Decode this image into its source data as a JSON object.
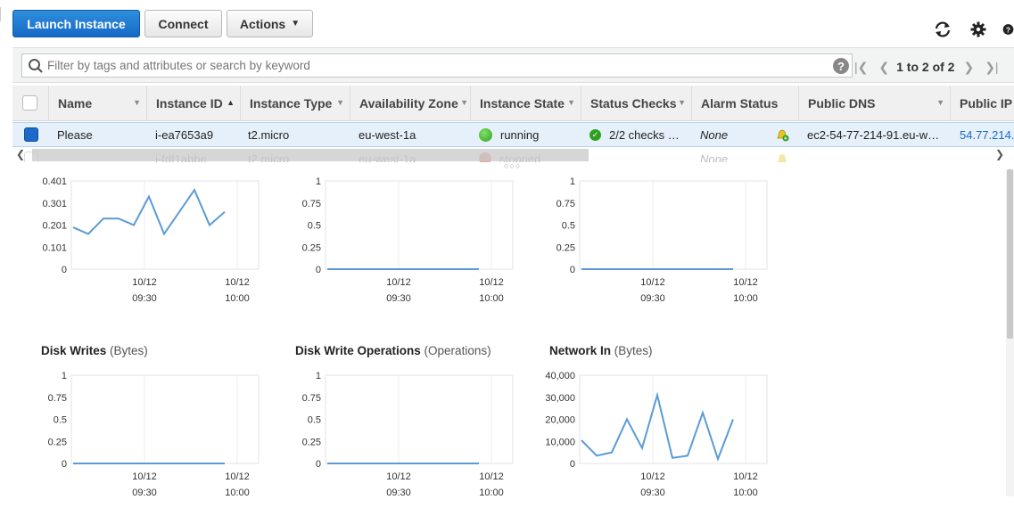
{
  "toolbar": {
    "launch_label": "Launch Instance",
    "connect_label": "Connect",
    "actions_label": "Actions"
  },
  "search": {
    "placeholder": "Filter by tags and attributes or search by keyword",
    "pager_text": "1 to 2 of 2"
  },
  "table": {
    "columns": [
      "Name",
      "Instance ID",
      "Instance Type",
      "Availability Zone",
      "Instance State",
      "Status Checks",
      "Alarm Status",
      "Public DNS",
      "Public IP"
    ],
    "rows": [
      {
        "name": "Please",
        "instance_id": "i-ea7653a9",
        "instance_type": "t2.micro",
        "zone": "eu-west-1a",
        "state": "running",
        "status_checks": "2/2 checks …",
        "alarm": "None",
        "public_dns": "ec2-54-77-214-91.eu-w…",
        "public_ip": "54.77.214."
      },
      {
        "name": "",
        "instance_id": "i-fdf1abbe",
        "instance_type": "t2.micro",
        "zone": "eu-west-1a",
        "state": "stopped",
        "status_checks": "",
        "alarm": "None",
        "public_dns": "",
        "public_ip": ""
      }
    ]
  },
  "colors": {
    "primary": "#1669c7",
    "line": "#5b9bd5",
    "running": "#36b021",
    "link": "#1b6ac9"
  },
  "chart_data": [
    {
      "type": "line",
      "title": "",
      "unit": "",
      "y_ticks": [
        "0.401",
        "0.301",
        "0.201",
        "0.101",
        "0"
      ],
      "ylim": [
        0,
        0.401
      ],
      "x_ticks": [
        {
          "date": "10/12",
          "time": "09:30"
        },
        {
          "date": "10/12",
          "time": "10:00"
        }
      ],
      "x": [
        "09:20",
        "09:24",
        "09:28",
        "09:32",
        "09:36",
        "09:40",
        "09:44",
        "09:48",
        "09:52",
        "09:56",
        "10:00"
      ],
      "series": [
        {
          "values": [
            0.19,
            0.16,
            0.23,
            0.23,
            0.2,
            0.33,
            0.16,
            0.26,
            0.36,
            0.2,
            0.26
          ]
        }
      ]
    },
    {
      "type": "line",
      "title": "",
      "unit": "",
      "y_ticks": [
        "1",
        "0.75",
        "0.5",
        "0.25",
        "0"
      ],
      "ylim": [
        0,
        1
      ],
      "x_ticks": [
        {
          "date": "10/12",
          "time": "09:30"
        },
        {
          "date": "10/12",
          "time": "10:00"
        }
      ],
      "x": [
        "09:20",
        "09:26",
        "09:32",
        "09:38",
        "09:44",
        "09:50",
        "09:56"
      ],
      "series": [
        {
          "values": [
            0,
            0,
            0,
            0,
            0,
            0,
            0
          ]
        }
      ]
    },
    {
      "type": "line",
      "title": "",
      "unit": "",
      "y_ticks": [
        "1",
        "0.75",
        "0.5",
        "0.25",
        "0"
      ],
      "ylim": [
        0,
        1
      ],
      "x_ticks": [
        {
          "date": "10/12",
          "time": "09:30"
        },
        {
          "date": "10/12",
          "time": "10:00"
        }
      ],
      "x": [
        "09:20",
        "09:26",
        "09:32",
        "09:38",
        "09:44",
        "09:50",
        "09:56"
      ],
      "series": [
        {
          "values": [
            0,
            0,
            0,
            0,
            0,
            0,
            0
          ]
        }
      ]
    },
    {
      "type": "line",
      "title": "Disk Writes",
      "unit": "(Bytes)",
      "y_ticks": [
        "1",
        "0.75",
        "0.5",
        "0.25",
        "0"
      ],
      "ylim": [
        0,
        1
      ],
      "x_ticks": [
        {
          "date": "10/12",
          "time": "09:30"
        },
        {
          "date": "10/12",
          "time": "10:00"
        }
      ],
      "x": [
        "09:20",
        "09:26",
        "09:32",
        "09:38",
        "09:44",
        "09:50",
        "09:56"
      ],
      "series": [
        {
          "values": [
            0,
            0,
            0,
            0,
            0,
            0,
            0
          ]
        }
      ]
    },
    {
      "type": "line",
      "title": "Disk Write Operations",
      "unit": "(Operations)",
      "y_ticks": [
        "1",
        "0.75",
        "0.5",
        "0.25",
        "0"
      ],
      "ylim": [
        0,
        1
      ],
      "x_ticks": [
        {
          "date": "10/12",
          "time": "09:30"
        },
        {
          "date": "10/12",
          "time": "10:00"
        }
      ],
      "x": [
        "09:20",
        "09:26",
        "09:32",
        "09:38",
        "09:44",
        "09:50",
        "09:56"
      ],
      "series": [
        {
          "values": [
            0,
            0,
            0,
            0,
            0,
            0,
            0
          ]
        }
      ]
    },
    {
      "type": "line",
      "title": "Network In",
      "unit": "(Bytes)",
      "y_ticks": [
        "40,000",
        "30,000",
        "20,000",
        "10,000",
        "0"
      ],
      "ylim": [
        0,
        40000
      ],
      "x_ticks": [
        {
          "date": "10/12",
          "time": "09:30"
        },
        {
          "date": "10/12",
          "time": "10:00"
        }
      ],
      "x": [
        "09:20",
        "09:24",
        "09:28",
        "09:32",
        "09:36",
        "09:40",
        "09:44",
        "09:48",
        "09:52",
        "09:56",
        "10:00"
      ],
      "series": [
        {
          "values": [
            10500,
            3500,
            5000,
            20000,
            7000,
            31000,
            2500,
            3500,
            23000,
            2000,
            20000
          ]
        }
      ]
    }
  ]
}
